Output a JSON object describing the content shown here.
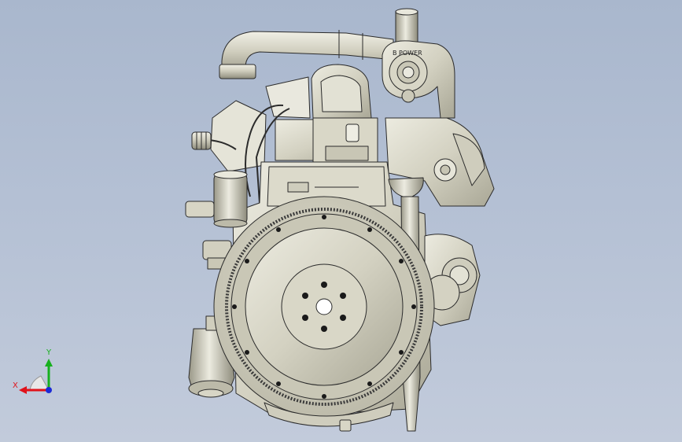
{
  "viewport": {
    "background_top": "#a9b7cd",
    "background_bottom": "#c2cbdb",
    "model_color": "#d6d4c4",
    "edge_color": "#2b2b2b"
  },
  "turbo_badge": "B POWER",
  "triad": {
    "x_label": "X",
    "y_label": "Y",
    "x_color": "#e0121a",
    "y_color": "#17b01e",
    "z_color": "#1c2bd6"
  }
}
